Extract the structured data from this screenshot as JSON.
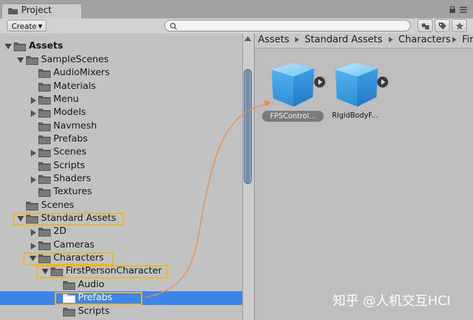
{
  "window": {
    "tab_label": "Project",
    "tab_icon": "folder-icon"
  },
  "toolbar": {
    "create_label": "Create",
    "search_placeholder": ""
  },
  "tree": {
    "items": [
      {
        "label": "Assets",
        "expanded": true,
        "bold": true
      },
      {
        "label": "SampleScenes",
        "expanded": true
      },
      {
        "label": "AudioMixers"
      },
      {
        "label": "Materials"
      },
      {
        "label": "Menu",
        "expandable": true
      },
      {
        "label": "Models",
        "expandable": true
      },
      {
        "label": "Navmesh"
      },
      {
        "label": "Prefabs"
      },
      {
        "label": "Scenes",
        "expandable": true
      },
      {
        "label": "Scripts"
      },
      {
        "label": "Shaders",
        "expandable": true
      },
      {
        "label": "Textures"
      },
      {
        "label": "Scenes"
      },
      {
        "label": "Standard Assets",
        "expanded": true,
        "highlighted": true
      },
      {
        "label": "2D",
        "expandable": true
      },
      {
        "label": "Cameras",
        "expandable": true
      },
      {
        "label": "Characters",
        "expanded": true,
        "highlighted": true
      },
      {
        "label": "FirstPersonCharacter",
        "expanded": true,
        "highlighted": true
      },
      {
        "label": "Audio"
      },
      {
        "label": "Prefabs",
        "selected": true,
        "highlighted": true
      },
      {
        "label": "Scripts"
      }
    ]
  },
  "breadcrumb": {
    "items": [
      "Assets",
      "Standard Assets",
      "Characters",
      "Fir"
    ]
  },
  "assets": [
    {
      "name": "FPSControl...",
      "selected": true
    },
    {
      "name": "RigidBodyF..."
    }
  ],
  "watermark": "知乎 @人机交互HCI",
  "colors": {
    "selection": "#3c86eb",
    "highlight_box": "#f0b428",
    "drag_arrow": "#ef8a3c",
    "cube": "#3fa6e8"
  }
}
